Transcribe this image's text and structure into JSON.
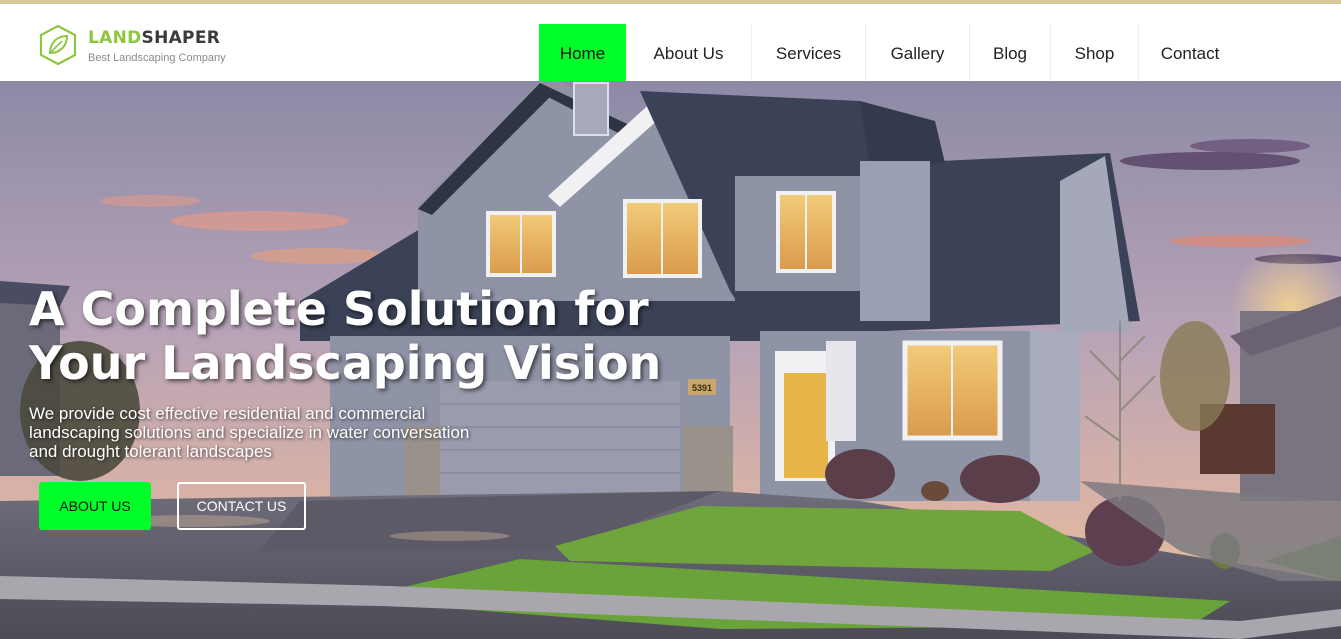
{
  "brand": {
    "name_part1": "LAND",
    "name_part2": "SHAPER",
    "tagline": "Best Landscaping Company"
  },
  "nav": {
    "items": [
      {
        "label": "Home",
        "active": true
      },
      {
        "label": "About Us",
        "active": false
      },
      {
        "label": "Services",
        "active": false
      },
      {
        "label": "Gallery",
        "active": false
      },
      {
        "label": "Blog",
        "active": false
      },
      {
        "label": "Shop",
        "active": false
      },
      {
        "label": "Contact",
        "active": false
      }
    ]
  },
  "hero": {
    "headline_line1": "A Complete Solution for",
    "headline_line2": "Your Landscaping Vision",
    "subtext": "We provide cost effective residential and commercial landscaping solutions and specialize in water conversation and drought tolerant landscapes",
    "house_number": "5391",
    "buttons": {
      "about_label": "ABOUT US",
      "contact_label": "CONTACT US"
    }
  },
  "colors": {
    "accent_green": "#00ff2a",
    "logo_green": "#8dc63f",
    "roof": "#3b4257",
    "siding": "#8f93a6"
  }
}
